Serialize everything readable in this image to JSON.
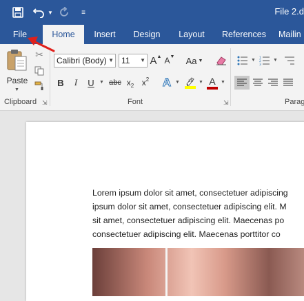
{
  "window": {
    "title": "File 2.d"
  },
  "tabs": [
    {
      "label": "File"
    },
    {
      "label": "Home"
    },
    {
      "label": "Insert"
    },
    {
      "label": "Design"
    },
    {
      "label": "Layout"
    },
    {
      "label": "References"
    },
    {
      "label": "Mailin"
    }
  ],
  "ribbon": {
    "clipboard": {
      "paste_label": "Paste",
      "group_label": "Clipboard"
    },
    "font": {
      "font_name": "Calibri (Body)",
      "font_size": "11",
      "group_label": "Font",
      "bold": "B",
      "italic": "I",
      "underline": "U",
      "strikethrough": "abc",
      "subscript": "x",
      "superscript": "x",
      "change_case": "Aa",
      "grow": "A",
      "shrink": "A",
      "text_effects": "A",
      "font_color": "A"
    },
    "paragraph": {
      "group_label": "Parag"
    }
  },
  "document": {
    "lines": [
      "Lorem ipsum dolor sit amet, consectetuer adipiscing",
      "ipsum dolor sit amet, consectetuer adipiscing elit. M",
      "sit amet, consectetuer adipiscing elit. Maecenas po",
      "consectetuer adipiscing elit. Maecenas porttitor co"
    ]
  },
  "colors": {
    "title_bar": "#2b579a",
    "ribbon_bg": "#f3f3f3",
    "highlight": "#ffff00",
    "font_color": "#c00000",
    "annotation_arrow": "#e0201b"
  }
}
